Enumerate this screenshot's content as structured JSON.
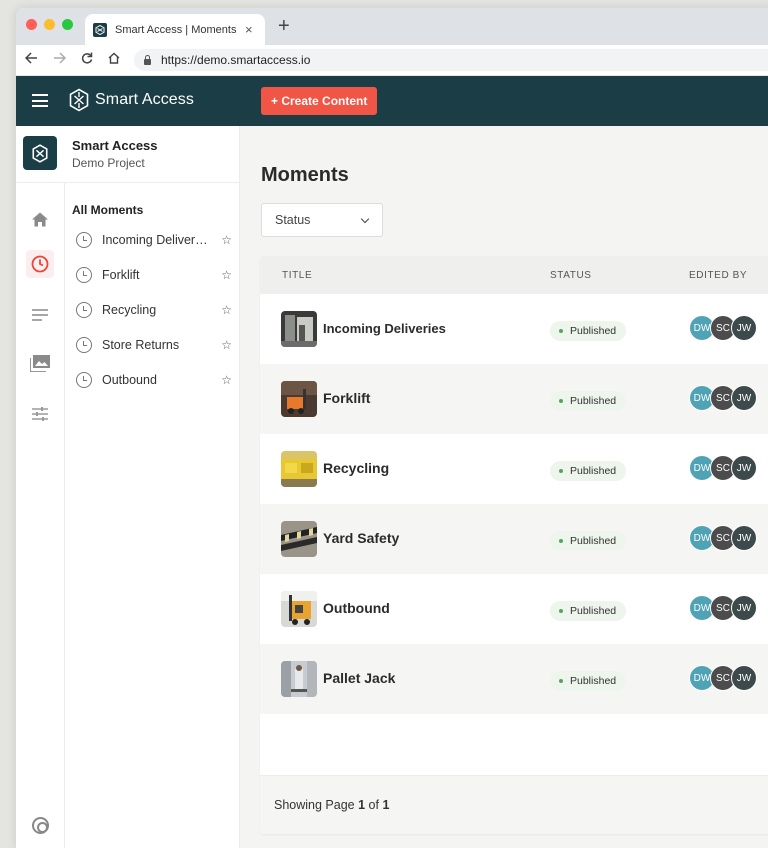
{
  "browser": {
    "tab_title": "Smart Access | Moments",
    "tab_close": "×",
    "new_tab": "+",
    "url": "https://demo.smartaccess.io"
  },
  "header": {
    "app_name": "Smart Access",
    "create_button": "+ Create Content",
    "accent_color": "#f05545",
    "bar_color": "#1b3d45"
  },
  "project": {
    "name": "Smart Access",
    "subtitle": "Demo Project"
  },
  "rail": {
    "icons": [
      "home-icon",
      "clock-icon",
      "lines-icon",
      "images-icon",
      "sliders-icon",
      "help-icon"
    ]
  },
  "sidebar": {
    "heading": "All Moments",
    "items": [
      {
        "label": "Incoming Deliveries"
      },
      {
        "label": "Forklift"
      },
      {
        "label": "Recycling"
      },
      {
        "label": "Store Returns"
      },
      {
        "label": "Outbound"
      }
    ],
    "star": "☆"
  },
  "main": {
    "title": "Moments",
    "status_filter": "Status",
    "columns": [
      "TITLE",
      "STATUS",
      "EDITED BY"
    ],
    "rows": [
      {
        "title": "Incoming Deliveries",
        "status": "Published",
        "editors": [
          "DW",
          "SC",
          "JW"
        ]
      },
      {
        "title": "Forklift",
        "status": "Published",
        "editors": [
          "DW",
          "SC",
          "JW"
        ]
      },
      {
        "title": "Recycling",
        "status": "Published",
        "editors": [
          "DW",
          "SC",
          "JW"
        ]
      },
      {
        "title": "Yard Safety",
        "status": "Published",
        "editors": [
          "DW",
          "SC",
          "JW"
        ]
      },
      {
        "title": "Outbound",
        "status": "Published",
        "editors": [
          "DW",
          "SC",
          "JW"
        ]
      },
      {
        "title": "Pallet Jack",
        "status": "Published",
        "editors": [
          "DW",
          "SC",
          "JW"
        ]
      }
    ],
    "footer": {
      "prefix": "Showing Page",
      "current": "1",
      "of": "of",
      "total": "1"
    }
  }
}
